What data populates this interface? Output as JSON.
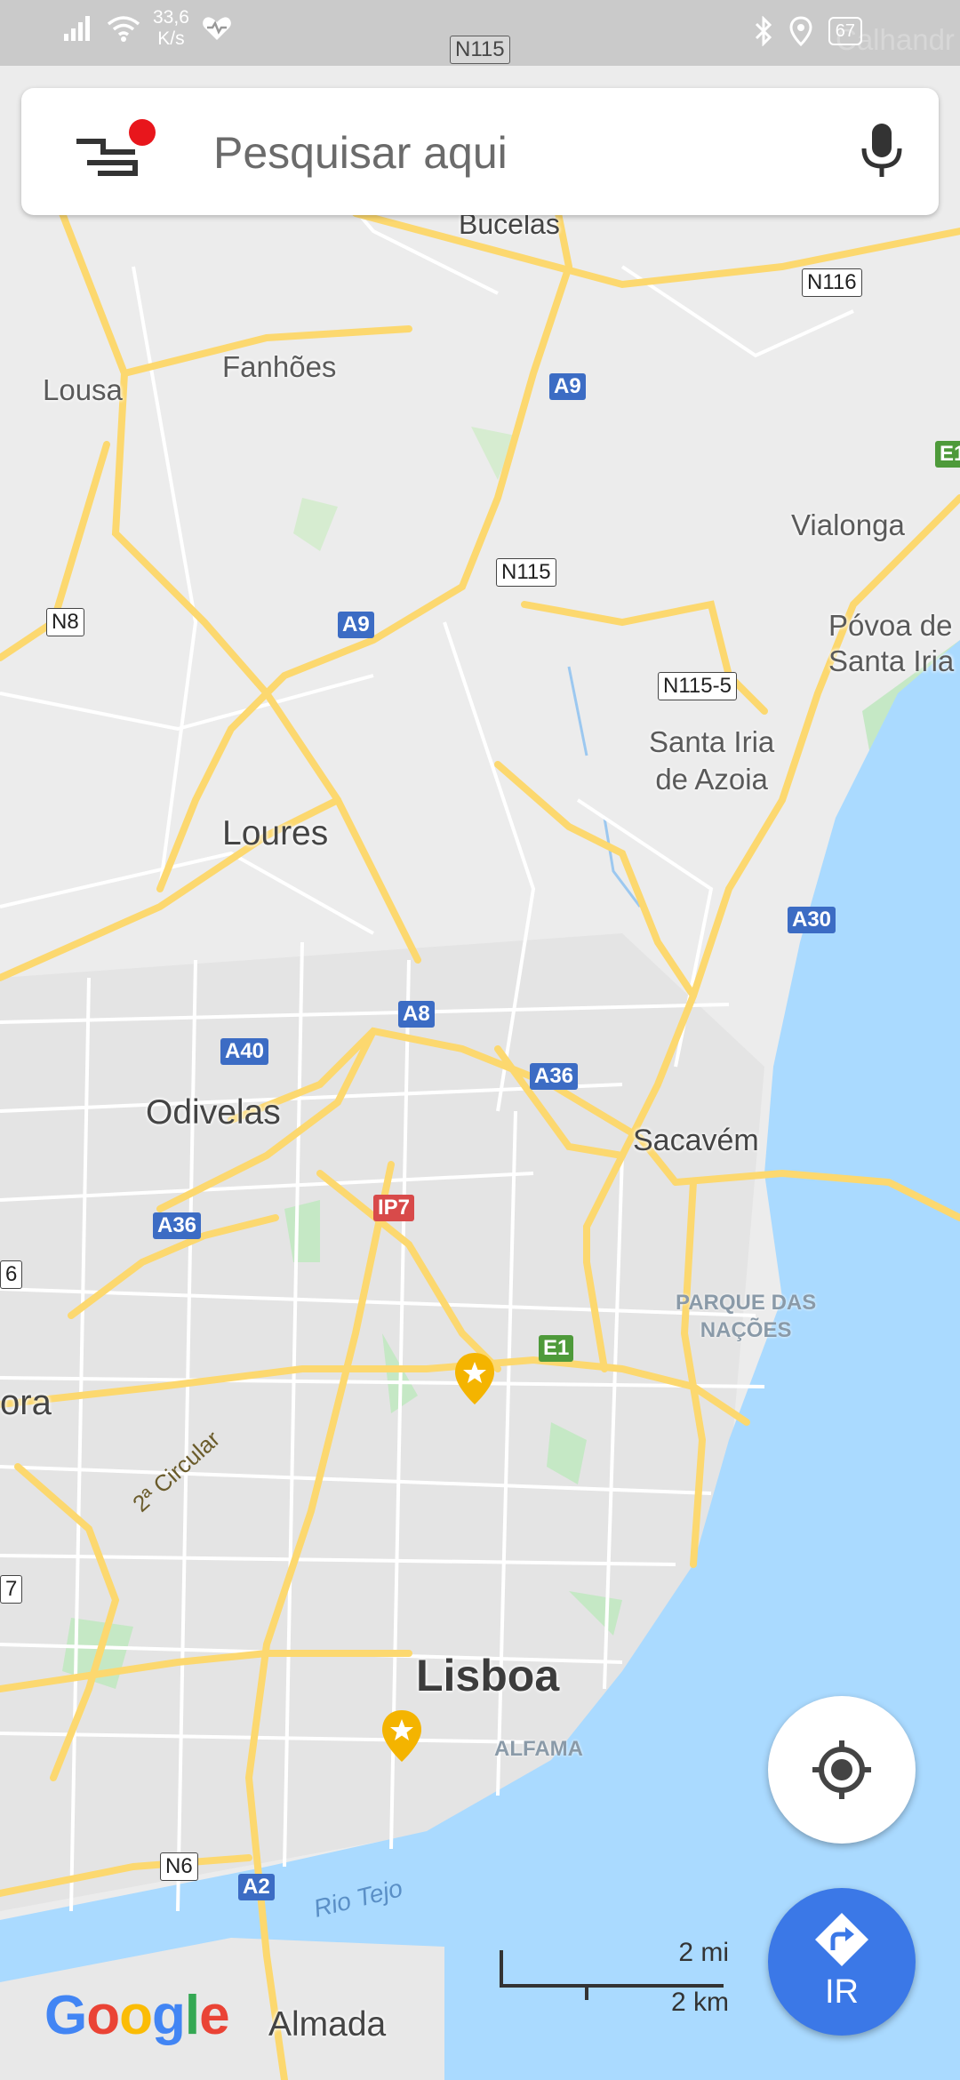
{
  "status_bar": {
    "speed_value": "33,6",
    "speed_unit": "K/s",
    "battery": "67",
    "icons": [
      "signal-icon",
      "wifi-icon",
      "health-icon",
      "bluetooth-icon",
      "location-icon",
      "battery-icon"
    ]
  },
  "search": {
    "placeholder": "Pesquisar aqui",
    "menu_icon": "menu-icon",
    "mic_icon": "mic-icon"
  },
  "map": {
    "places": {
      "bucelas": "Bucelas",
      "fanhoes": "Fanhões",
      "lousa": "Lousa",
      "vialonga": "Vialonga",
      "povoa": "Póvoa de\nSanta Iria",
      "santa_iria": "Santa Iria\nde Azoia",
      "loures": "Loures",
      "odivelas": "Odivelas",
      "sacavem": "Sacavém",
      "parque": "PARQUE DAS\nNAÇÕES",
      "lisboa": "Lisboa",
      "alfama": "ALFAMA",
      "almada": "Almada",
      "ora": "ora",
      "calhandr": "Calhandr"
    },
    "water": {
      "rio_tejo": "Rio Tejo"
    },
    "road_name": "2ª Circular",
    "shields": {
      "n115_top": "N115",
      "n116": "N116",
      "a9_top": "A9",
      "e1_edge": "E1",
      "n115_mid": "N115",
      "n8": "N8",
      "a9_mid": "A9",
      "n115_5": "N115-5",
      "a30": "A30",
      "a8": "A8",
      "a40": "A40",
      "a36_right": "A36",
      "a36_left": "A36",
      "ip7": "IP7",
      "e1": "E1",
      "n6": "N6",
      "a2": "A2",
      "edge6": "6",
      "edge7": "7"
    },
    "colors": {
      "land": "#ececec",
      "water": "#aadaff",
      "park": "#c5e8c5",
      "highway": "#fcd86f",
      "street": "#ffffff"
    }
  },
  "controls": {
    "my_location_icon": "crosshair-icon",
    "go_icon": "directions-icon",
    "go_label": "IR"
  },
  "scale": {
    "miles": "2 mi",
    "km": "2 km"
  },
  "logo": {
    "letters": [
      "G",
      "o",
      "o",
      "g",
      "l",
      "e"
    ],
    "colors": [
      "#4285F4",
      "#EA4335",
      "#FBBC05",
      "#4285F4",
      "#34A853",
      "#EA4335"
    ]
  }
}
